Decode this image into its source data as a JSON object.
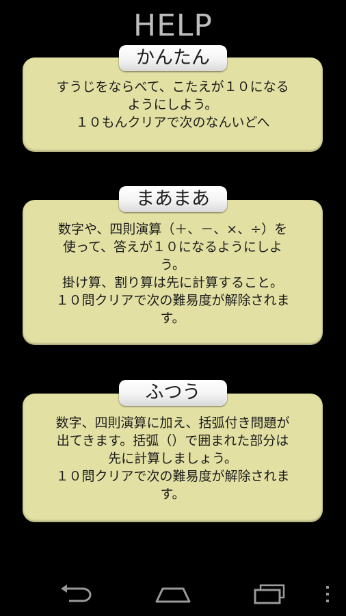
{
  "header": {
    "title": "HELP"
  },
  "sections": [
    {
      "tab": "かんたん",
      "text": "すうじをならべて、こたえが１０になる\nようにしよう。\n１０もんクリアで次のなんいどへ"
    },
    {
      "tab": "まあまあ",
      "text": "数字や、四則演算（＋、－、×、÷）を\n使って、答えが１０になるようにしよ\nう。\n掛け算、割り算は先に計算すること。\n１０問クリアで次の難易度が解除されま\nす。"
    },
    {
      "tab": "ふつう",
      "text": "数字、四則演算に加え、括弧付き問題が\n出てきます。括弧（）で囲まれた部分は\n先に計算しましょう。\n１０問クリアで次の難易度が解除されま\nす。"
    }
  ],
  "navbar": {
    "back": "back-icon",
    "home": "home-icon",
    "recents": "recents-icon",
    "menu": "overflow-menu-icon"
  },
  "colors": {
    "background": "#000000",
    "card": "#e2e0a3",
    "title": "#bdbdbd"
  }
}
